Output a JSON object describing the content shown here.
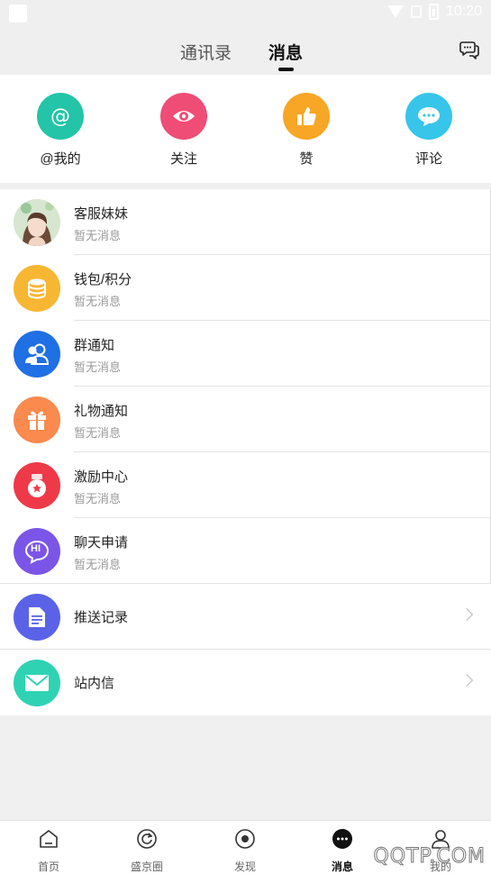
{
  "status_bar": {
    "time": "10:20"
  },
  "header": {
    "tabs": [
      {
        "label": "通讯录"
      },
      {
        "label": "消息"
      }
    ]
  },
  "quick_actions": [
    {
      "label": "@我的",
      "icon": "at-icon",
      "color": "#23c4a7"
    },
    {
      "label": "关注",
      "icon": "eye-icon",
      "color": "#ef4d76"
    },
    {
      "label": "赞",
      "icon": "thumbs-up-icon",
      "color": "#f7a625"
    },
    {
      "label": "评论",
      "icon": "comment-icon",
      "color": "#37c5ea"
    }
  ],
  "messages": [
    {
      "title": "客服妹妹",
      "subtitle": "暂无消息",
      "icon": "avatar"
    },
    {
      "title": "钱包/积分",
      "subtitle": "暂无消息",
      "icon": "coins-icon",
      "color": "#f7b733"
    },
    {
      "title": "群通知",
      "subtitle": "暂无消息",
      "icon": "group-icon",
      "color": "#1f6fe5"
    },
    {
      "title": "礼物通知",
      "subtitle": "暂无消息",
      "icon": "gift-icon",
      "color": "#fb8a4e"
    },
    {
      "title": "激励中心",
      "subtitle": "暂无消息",
      "icon": "medal-icon",
      "color": "#ee3a48"
    },
    {
      "title": "聊天申请",
      "subtitle": "暂无消息",
      "icon": "hi-bubble-icon",
      "color": "#7b55e8",
      "badge": "HI"
    },
    {
      "title": "推送记录",
      "icon": "document-icon",
      "color": "#5a63e8"
    },
    {
      "title": "站内信",
      "icon": "mail-icon",
      "color": "#2fd3b4"
    }
  ],
  "bottom_nav": [
    {
      "label": "首页"
    },
    {
      "label": "盛京圈"
    },
    {
      "label": "发现"
    },
    {
      "label": "消息"
    },
    {
      "label": "我的"
    }
  ],
  "watermark": "QQTP.COM"
}
